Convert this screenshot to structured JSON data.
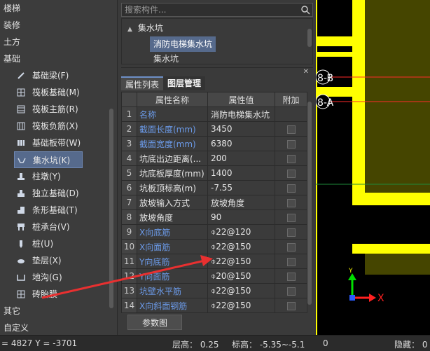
{
  "left_nav": {
    "categories_top": [
      "楼梯",
      "装修",
      "土方",
      "基础"
    ],
    "items": [
      {
        "label": "基础梁(F)",
        "icon": "beam-icon"
      },
      {
        "label": "筏板基础(M)",
        "icon": "raft-icon"
      },
      {
        "label": "筏板主筋(R)",
        "icon": "rebar-grid-icon"
      },
      {
        "label": "筏板负筋(X)",
        "icon": "neg-rebar-icon"
      },
      {
        "label": "基础板带(W)",
        "icon": "strip-icon"
      },
      {
        "label": "集水坑(K)",
        "icon": "sump-icon",
        "selected": true
      },
      {
        "label": "柱墩(Y)",
        "icon": "pier-icon"
      },
      {
        "label": "独立基础(D)",
        "icon": "isolated-footing-icon"
      },
      {
        "label": "条形基础(T)",
        "icon": "strip-footing-icon"
      },
      {
        "label": "桩承台(V)",
        "icon": "pile-cap-icon"
      },
      {
        "label": "桩(U)",
        "icon": "pile-icon"
      },
      {
        "label": "垫层(X)",
        "icon": "cushion-icon"
      },
      {
        "label": "地沟(G)",
        "icon": "trench-icon"
      },
      {
        "label": "砖胎膜",
        "icon": "brick-mold-icon"
      }
    ],
    "categories_bottom": [
      "其它",
      "自定义"
    ]
  },
  "search": {
    "placeholder": "搜索构件..."
  },
  "tree": {
    "parent": "集水坑",
    "children": [
      {
        "label": "消防电梯集水坑",
        "selected": true
      },
      {
        "label": "集水坑"
      }
    ]
  },
  "tabs": [
    {
      "label": "属性列表",
      "active": true
    },
    {
      "label": "图层管理",
      "active": false
    }
  ],
  "table": {
    "headers": [
      "属性名称",
      "属性值",
      "附加"
    ],
    "rows": [
      {
        "num": "1",
        "name": "名称",
        "value": "消防电梯集水坑",
        "blue": true,
        "check": false
      },
      {
        "num": "2",
        "name": "截面长度(mm)",
        "value": "3450",
        "blue": true,
        "check": true
      },
      {
        "num": "3",
        "name": "截面宽度(mm)",
        "value": "6380",
        "blue": true,
        "check": true
      },
      {
        "num": "4",
        "name": "坑底出边距离(...",
        "value": "200",
        "blue": false,
        "check": true
      },
      {
        "num": "5",
        "name": "坑底板厚度(mm)",
        "value": "1400",
        "blue": false,
        "check": true
      },
      {
        "num": "6",
        "name": "坑板顶标高(m)",
        "value": "-7.55",
        "blue": false,
        "check": true
      },
      {
        "num": "7",
        "name": "放坡输入方式",
        "value": "放坡角度",
        "blue": false,
        "check": true
      },
      {
        "num": "8",
        "name": "放坡角度",
        "value": "90",
        "blue": false,
        "check": true
      },
      {
        "num": "9",
        "name": "X向底筋",
        "value": "⌽22@120",
        "blue": true,
        "check": true
      },
      {
        "num": "10",
        "name": "X向面筋",
        "value": "⌽22@150",
        "blue": true,
        "check": true
      },
      {
        "num": "11",
        "name": "Y向底筋",
        "value": "⌽22@150",
        "blue": true,
        "check": true
      },
      {
        "num": "12",
        "name": "Y向面筋",
        "value": "⌽20@150",
        "blue": true,
        "check": true
      },
      {
        "num": "13",
        "name": "坑壁水平筋",
        "value": "⌽22@150",
        "blue": true,
        "check": true
      },
      {
        "num": "14",
        "name": "X向斜面钢筋",
        "value": "⌽22@150",
        "blue": true,
        "check": true
      }
    ]
  },
  "param_button": "参数图",
  "canvas": {
    "axis_labels": [
      "8-B",
      "8-A"
    ],
    "axis_x_label": "X",
    "axis_y_label": "Y"
  },
  "status": {
    "coords": "= 4827 Y = -3701",
    "floor_height": "层高： 0.25",
    "elevation": "标高： -5.35~-5.1",
    "zero": "0",
    "hidden": "隐藏： 0"
  },
  "colors": {
    "selected_bg": "#566a8c",
    "blue_text": "#6b9ae8",
    "cad_yellow": "#ffff00",
    "cad_olive": "#454500",
    "cad_red": "#ff2a2a",
    "annotation_red": "#e83030"
  }
}
